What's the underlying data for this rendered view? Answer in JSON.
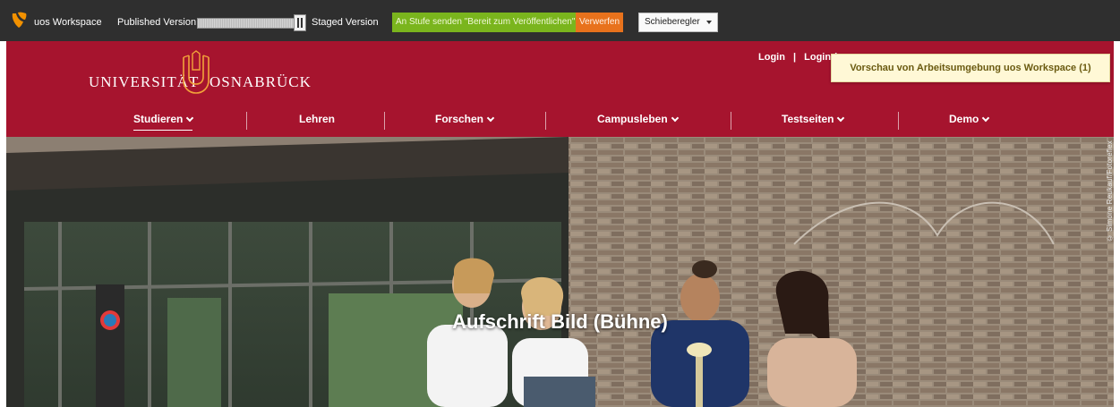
{
  "workspace_bar": {
    "title": "uos Workspace",
    "published_label": "Published Version",
    "staged_label": "Staged Version",
    "send_button": "An Stufe senden \"Bereit zum Veröffentlichen\"",
    "discard_button": "Verwerfen",
    "view_select": "Schieberegler",
    "colors": {
      "background": "#2f2f2f",
      "send": "#7ab51d",
      "discard": "#e8721c",
      "logo": "#f29100"
    }
  },
  "header": {
    "logo_left": "UNIVERSITÄT",
    "logo_right": "OSNABRÜCK",
    "login_links": [
      "Login",
      "|",
      "Login ("
    ],
    "preview_tooltip": "Vorschau von Arbeitsumgebung uos Workspace (1)",
    "colors": {
      "background": "#a6142e"
    }
  },
  "nav": {
    "items": [
      {
        "label": "Studieren",
        "has_dropdown": true,
        "active": true
      },
      {
        "label": "Lehren",
        "has_dropdown": false,
        "active": false
      },
      {
        "label": "Forschen",
        "has_dropdown": true,
        "active": false
      },
      {
        "label": "Campusleben",
        "has_dropdown": true,
        "active": false
      },
      {
        "label": "Testseiten",
        "has_dropdown": true,
        "active": false
      },
      {
        "label": "Demo",
        "has_dropdown": true,
        "active": false
      }
    ]
  },
  "stage": {
    "caption": "Aufschrift Bild (Bühne)",
    "photo_credit": "© Simone Reukauf/Fotoreflex"
  }
}
